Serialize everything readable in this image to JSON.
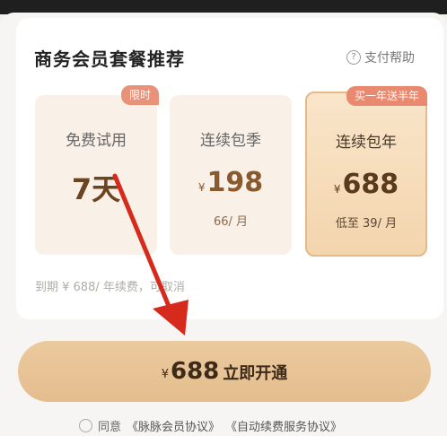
{
  "header": {
    "title": "商务会员套餐推荐",
    "help_label": "支付帮助",
    "help_icon": "question-circle-icon"
  },
  "plans": [
    {
      "name": "免费试用",
      "badge": "限时",
      "currency": "",
      "price": "7天",
      "sub": ""
    },
    {
      "name": "连续包季",
      "badge": "",
      "currency": "¥",
      "price": "198",
      "sub": "66/ 月"
    },
    {
      "name": "连续包年",
      "badge": "买一年送半年",
      "currency": "¥",
      "price": "688",
      "sub": "低至 39/ 月",
      "selected": true
    }
  ],
  "renewal_note": "到期 ¥ 688/ 年续费，可取消",
  "cta": {
    "currency": "¥",
    "amount": "688",
    "label": "立即开通"
  },
  "agreement": {
    "prefix": "同意",
    "link1": "《脉脉会员协议》",
    "link2": "《自动续费服务协议》"
  },
  "colors": {
    "accent": "#e4bd8d",
    "badge": "#e8927a",
    "annotation_arrow": "#d62a1c"
  }
}
